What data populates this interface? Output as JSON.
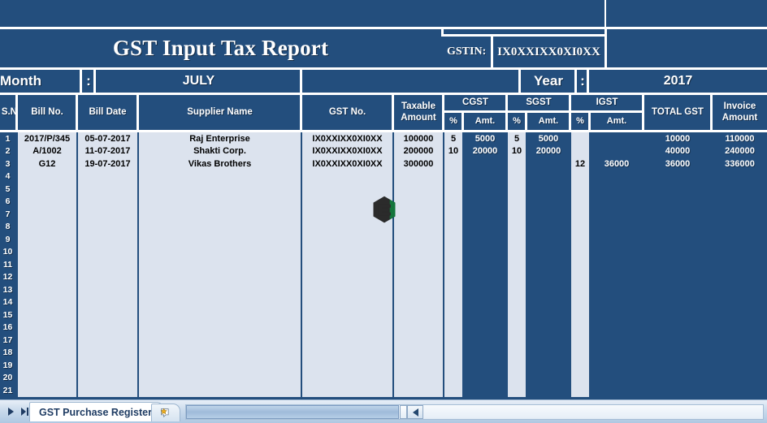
{
  "app": {
    "accent_dark": "#234E7D",
    "cell_light": "#DCE3EE",
    "logo_dark": "#2B2B2B",
    "logo_green": "#14763C"
  },
  "report": {
    "title": "GST Input Tax Report",
    "gstin_label": "GSTIN:",
    "gstin_value": "IX0XXIXX0XI0XX",
    "month_label": "Month",
    "month_colon": ":",
    "month_value": "JULY",
    "year_label": "Year",
    "year_colon": ":",
    "year_value": "2017"
  },
  "table": {
    "headers": {
      "sn": "S.N.",
      "bill_no": "Bill No.",
      "bill_date": "Bill Date",
      "supplier_name": "Supplier Name",
      "gst_no": "GST No.",
      "taxable_amount": "Taxable Amount",
      "cgst": "CGST",
      "sgst": "SGST",
      "igst": "IGST",
      "pct": "%",
      "amt": "Amt.",
      "total_gst": "TOTAL GST",
      "invoice_amount": "Invoice Amount"
    },
    "row_numbers": [
      1,
      2,
      3,
      4,
      5,
      6,
      7,
      8,
      9,
      10,
      11,
      12,
      13,
      14,
      15,
      16,
      17,
      18,
      19,
      20,
      21
    ],
    "rows": [
      {
        "sn": "1",
        "bill_no": "2017/P/345",
        "bill_date": "05-07-2017",
        "supplier_name": "Raj Enterprise",
        "gst_no": "IX0XXIXX0XI0XX",
        "taxable_amount": "100000",
        "cgst_pct": "5",
        "cgst_amt": "5000",
        "sgst_pct": "5",
        "sgst_amt": "5000",
        "igst_pct": "",
        "igst_amt": "",
        "total_gst": "10000",
        "invoice_amount": "110000"
      },
      {
        "sn": "2",
        "bill_no": "A/1002",
        "bill_date": "11-07-2017",
        "supplier_name": "Shakti Corp.",
        "gst_no": "IX0XXIXX0XI0XX",
        "taxable_amount": "200000",
        "cgst_pct": "10",
        "cgst_amt": "20000",
        "sgst_pct": "10",
        "sgst_amt": "20000",
        "igst_pct": "",
        "igst_amt": "",
        "total_gst": "40000",
        "invoice_amount": "240000"
      },
      {
        "sn": "3",
        "bill_no": "G12",
        "bill_date": "19-07-2017",
        "supplier_name": "Vikas Brothers",
        "gst_no": "IX0XXIXX0XI0XX",
        "taxable_amount": "300000",
        "cgst_pct": "",
        "cgst_amt": "",
        "sgst_pct": "",
        "sgst_amt": "",
        "igst_pct": "12",
        "igst_amt": "36000",
        "total_gst": "36000",
        "invoice_amount": "336000"
      }
    ]
  },
  "tabbar": {
    "sheet_tab_label": "GST Purchase Register",
    "nav_next_icon": "next-sheet-arrow-icon",
    "nav_last_icon": "last-sheet-arrow-icon",
    "new_sheet_icon": "new-sheet-icon",
    "scroll_left_icon": "scroll-left-arrow-icon"
  },
  "watermark": {
    "icon": "hexagon-e-logo-icon"
  }
}
